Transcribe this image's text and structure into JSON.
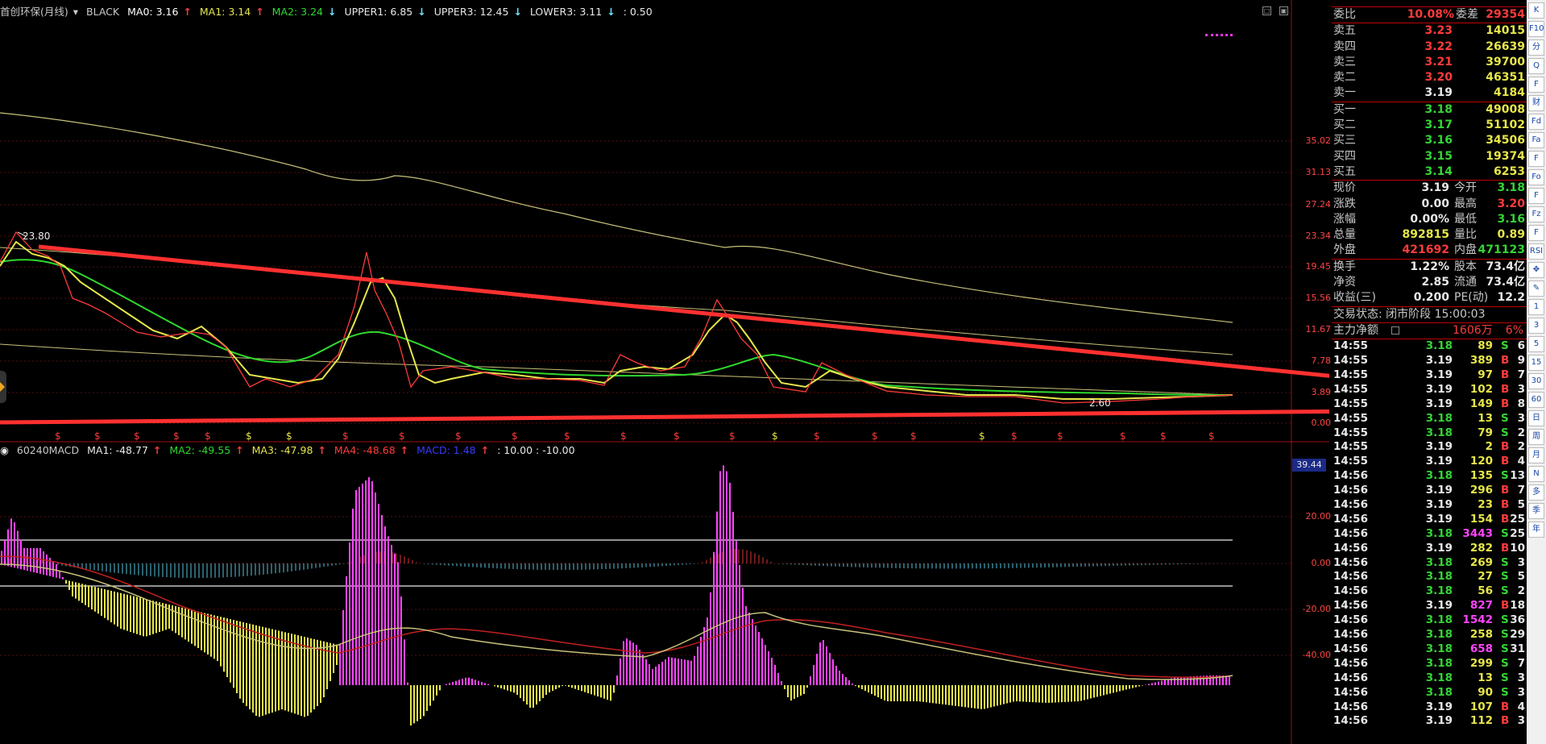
{
  "main_chart": {
    "legend": {
      "title": "首创环保(月线)",
      "style": "BLACK",
      "ma0_label": "MA0: 3.16",
      "ma1_label": "MA1: 3.14",
      "ma2_label": "MA2: 3.24",
      "upper1_label": "UPPER1: 6.85",
      "upper3_label": "UPPER3: 12.45",
      "lower3_label": "LOWER3: 3.11",
      "extra_label": ": 0.50"
    },
    "high_marker": "23.80",
    "low_marker": "2.60",
    "y_ticks": [
      "35.02",
      "31.13",
      "27.24",
      "23.34",
      "19.45",
      "15.56",
      "11.67",
      "7.78",
      "3.89",
      "0.00"
    ],
    "dollar_marker": "$"
  },
  "macd_chart": {
    "legend": {
      "title": "60240MACD",
      "ma1_label": "MA1: -48.77",
      "ma2_label": "MA2: -49.55",
      "ma3_label": "MA3: -47.98",
      "ma4_label": "MA4: -48.68",
      "macd_label": "MACD: 1.48",
      "extra_label": ": 10.00 : -10.00"
    },
    "current_value": "39.44",
    "y_ticks": [
      "20.00",
      "0.00",
      "-20.00",
      "-40.00"
    ]
  },
  "quote_panel": {
    "header": {
      "weibi_label": "委比",
      "weibi_value": "10.08%",
      "weicha_label": "委差",
      "weicha_value": "29354"
    },
    "asks": [
      {
        "label": "卖五",
        "price": "3.23",
        "volume": "14015"
      },
      {
        "label": "卖四",
        "price": "3.22",
        "volume": "26639"
      },
      {
        "label": "卖三",
        "price": "3.21",
        "volume": "39700"
      },
      {
        "label": "卖二",
        "price": "3.20",
        "volume": "46351"
      },
      {
        "label": "卖一",
        "price": "3.19",
        "volume": "4184"
      }
    ],
    "bids": [
      {
        "label": "买一",
        "price": "3.18",
        "volume": "49008"
      },
      {
        "label": "买二",
        "price": "3.17",
        "volume": "51102"
      },
      {
        "label": "买三",
        "price": "3.16",
        "volume": "34506"
      },
      {
        "label": "买四",
        "price": "3.15",
        "volume": "19374"
      },
      {
        "label": "买五",
        "price": "3.14",
        "volume": "6253"
      }
    ],
    "stats": [
      {
        "l1": "现价",
        "v1": "3.19",
        "l2": "今开",
        "v2": "3.18"
      },
      {
        "l1": "涨跌",
        "v1": "0.00",
        "l2": "最高",
        "v2": "3.20"
      },
      {
        "l1": "涨幅",
        "v1": "0.00%",
        "l2": "最低",
        "v2": "3.16"
      },
      {
        "l1": "总量",
        "v1": "892815",
        "l2": "量比",
        "v2": "0.89"
      },
      {
        "l1": "外盘",
        "v1": "421692",
        "l2": "内盘",
        "v2": "471123"
      }
    ],
    "stats2": [
      {
        "l1": "换手",
        "v1": "1.22%",
        "l2": "股本",
        "v2": "73.4亿"
      },
      {
        "l1": "净资",
        "v1": "2.85",
        "l2": "流通",
        "v2": "73.4亿"
      },
      {
        "l1": "收益(三)",
        "v1": "0.200",
        "l2": "PE(动)",
        "v2": "12.2"
      }
    ],
    "trade_status": "交易状态: 闭市阶段 15:00:03",
    "main_force": {
      "label": "主力净额",
      "value": "1606万",
      "pct": "6%"
    },
    "ticks": [
      {
        "t": "14:55",
        "p": "3.18",
        "v": "89",
        "s": "S",
        "n": "6"
      },
      {
        "t": "14:55",
        "p": "3.19",
        "v": "389",
        "s": "B",
        "n": "9"
      },
      {
        "t": "14:55",
        "p": "3.19",
        "v": "97",
        "s": "B",
        "n": "7"
      },
      {
        "t": "14:55",
        "p": "3.19",
        "v": "102",
        "s": "B",
        "n": "3"
      },
      {
        "t": "14:55",
        "p": "3.19",
        "v": "149",
        "s": "B",
        "n": "8"
      },
      {
        "t": "14:55",
        "p": "3.18",
        "v": "13",
        "s": "S",
        "n": "3"
      },
      {
        "t": "14:55",
        "p": "3.18",
        "v": "79",
        "s": "S",
        "n": "2"
      },
      {
        "t": "14:55",
        "p": "3.19",
        "v": "2",
        "s": "B",
        "n": "2"
      },
      {
        "t": "14:55",
        "p": "3.19",
        "v": "120",
        "s": "B",
        "n": "4"
      },
      {
        "t": "14:56",
        "p": "3.18",
        "v": "135",
        "s": "S",
        "n": "13"
      },
      {
        "t": "14:56",
        "p": "3.19",
        "v": "296",
        "s": "B",
        "n": "7"
      },
      {
        "t": "14:56",
        "p": "3.19",
        "v": "23",
        "s": "B",
        "n": "5"
      },
      {
        "t": "14:56",
        "p": "3.19",
        "v": "154",
        "s": "B",
        "n": "25"
      },
      {
        "t": "14:56",
        "p": "3.18",
        "v": "3443",
        "s": "S",
        "n": "25"
      },
      {
        "t": "14:56",
        "p": "3.19",
        "v": "282",
        "s": "B",
        "n": "10"
      },
      {
        "t": "14:56",
        "p": "3.18",
        "v": "269",
        "s": "S",
        "n": "3"
      },
      {
        "t": "14:56",
        "p": "3.18",
        "v": "27",
        "s": "S",
        "n": "5"
      },
      {
        "t": "14:56",
        "p": "3.18",
        "v": "56",
        "s": "S",
        "n": "2"
      },
      {
        "t": "14:56",
        "p": "3.19",
        "v": "827",
        "s": "B",
        "n": "18"
      },
      {
        "t": "14:56",
        "p": "3.18",
        "v": "1542",
        "s": "S",
        "n": "36"
      },
      {
        "t": "14:56",
        "p": "3.18",
        "v": "258",
        "s": "S",
        "n": "29"
      },
      {
        "t": "14:56",
        "p": "3.18",
        "v": "658",
        "s": "S",
        "n": "31"
      },
      {
        "t": "14:56",
        "p": "3.18",
        "v": "299",
        "s": "S",
        "n": "7"
      },
      {
        "t": "14:56",
        "p": "3.18",
        "v": "13",
        "s": "S",
        "n": "3"
      },
      {
        "t": "14:56",
        "p": "3.18",
        "v": "90",
        "s": "S",
        "n": "3"
      },
      {
        "t": "14:56",
        "p": "3.19",
        "v": "107",
        "s": "B",
        "n": "4"
      },
      {
        "t": "14:56",
        "p": "3.19",
        "v": "112",
        "s": "B",
        "n": "3"
      }
    ]
  },
  "toolbar": {
    "buttons": [
      "K",
      "F10",
      "分",
      "Q",
      "F",
      "财",
      "Fd",
      "Fa",
      "F",
      "Fo",
      "F",
      "Fz",
      "F",
      "RSI",
      "✥",
      "✎",
      "1",
      "3",
      "5",
      "15",
      "30",
      "60",
      "日",
      "周",
      "月",
      "N",
      "多",
      "季",
      "年"
    ]
  },
  "colors": {
    "up": "#ff3b3b",
    "down": "#35d435",
    "ma_yellow": "#e6e64a",
    "ma_green": "#2ed82e",
    "upper_band": "#c8c27a",
    "macd_pos": "#ff44ff",
    "macd_neg": "#e6e64a",
    "trend_arrow": "#ff3030",
    "hist_pos": "#b03030",
    "hist_neg": "#4aa3b8"
  }
}
